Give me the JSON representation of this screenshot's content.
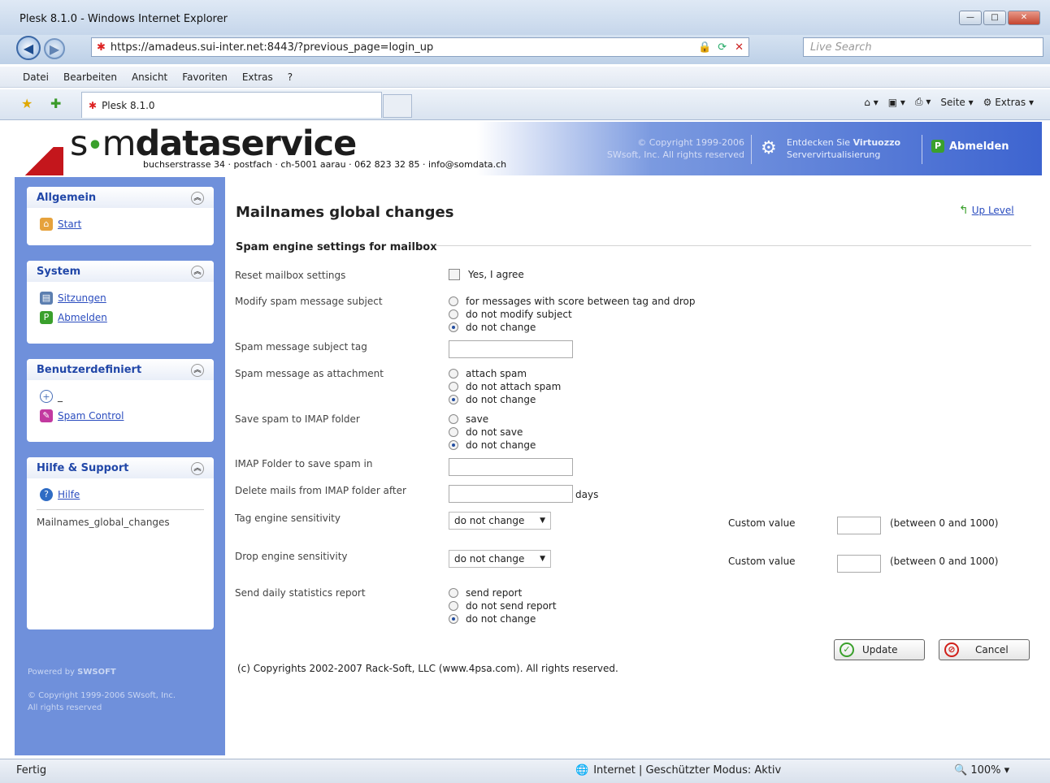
{
  "browser": {
    "title": "Plesk 8.1.0 - Windows Internet Explorer",
    "url": "https://amadeus.sui-inter.net:8443/?previous_page=login_up",
    "search_placeholder": "Live Search",
    "menu": [
      "Datei",
      "Bearbeiten",
      "Ansicht",
      "Favoriten",
      "Extras",
      "?"
    ],
    "tab_label": "Plesk 8.1.0",
    "cmd_page": "Seite",
    "cmd_extras": "Extras",
    "status_left": "Fertig",
    "status_zone": "Internet | Geschützter Modus: Aktiv",
    "zoom": "100%"
  },
  "header": {
    "logo_prefix": "s",
    "logo_dot": "•",
    "logo_mid": "m",
    "logo_bold": "dataservice",
    "address": "buchserstrasse 34 · postfach · ch-5001 aarau · 062 823 32 85 · info@somdata.ch",
    "copyright_line1": "© Copyright 1999-2006",
    "copyright_line2": "SWsoft, Inc. All rights reserved",
    "virtuozzo_line1_pre": "Entdecken Sie ",
    "virtuozzo_line1_bold": "Virtuozzo",
    "virtuozzo_line2": "Servervirtualisierung",
    "logout": "Abmelden"
  },
  "sidebar": {
    "groups": [
      {
        "title": "Allgemein",
        "items": [
          "Start"
        ]
      },
      {
        "title": "System",
        "items": [
          "Sitzungen",
          "Abmelden"
        ]
      },
      {
        "title": "Benutzerdefiniert",
        "items": [
          "_",
          "Spam Control"
        ]
      },
      {
        "title": "Hilfe & Support",
        "items": [
          "Hilfe"
        ],
        "context": "Mailnames_global_changes"
      }
    ],
    "powered_by": "Powered by",
    "powered_brand": "SWSOFT",
    "footer_line1": "© Copyright 1999-2006 SWsoft, Inc.",
    "footer_line2": "All rights reserved"
  },
  "main": {
    "title": "Mailnames global changes",
    "up_level": "Up Level",
    "section": "Spam engine settings for mailbox",
    "reset_label": "Reset mailbox settings",
    "reset_option": "Yes, I agree",
    "modify_label": "Modify spam message subject",
    "modify_options": [
      "for messages with score between tag and drop",
      "do not modify subject",
      "do not change"
    ],
    "tag_label": "Spam message subject tag",
    "attach_label": "Spam message as attachment",
    "attach_options": [
      "attach spam",
      "do not attach spam",
      "do not change"
    ],
    "save_label": "Save spam to IMAP folder",
    "save_options": [
      "save",
      "do not save",
      "do not change"
    ],
    "imap_folder_label": "IMAP Folder to save spam in",
    "delete_label": "Delete mails from IMAP folder after",
    "delete_unit": "days",
    "tag_sens_label": "Tag engine sensitivity",
    "tag_sens_value": "do not change",
    "drop_sens_label": "Drop engine sensitivity",
    "drop_sens_value": "do not change",
    "custom_value_label": "Custom value",
    "custom_range": "(between 0 and 1000)",
    "report_label": "Send daily statistics report",
    "report_options": [
      "send report",
      "do not send report",
      "do not change"
    ],
    "update_button": "Update",
    "cancel_button": "Cancel",
    "footer": "(c) Copyrights 2002-2007 Rack-Soft, LLC (www.4psa.com). All rights reserved."
  }
}
